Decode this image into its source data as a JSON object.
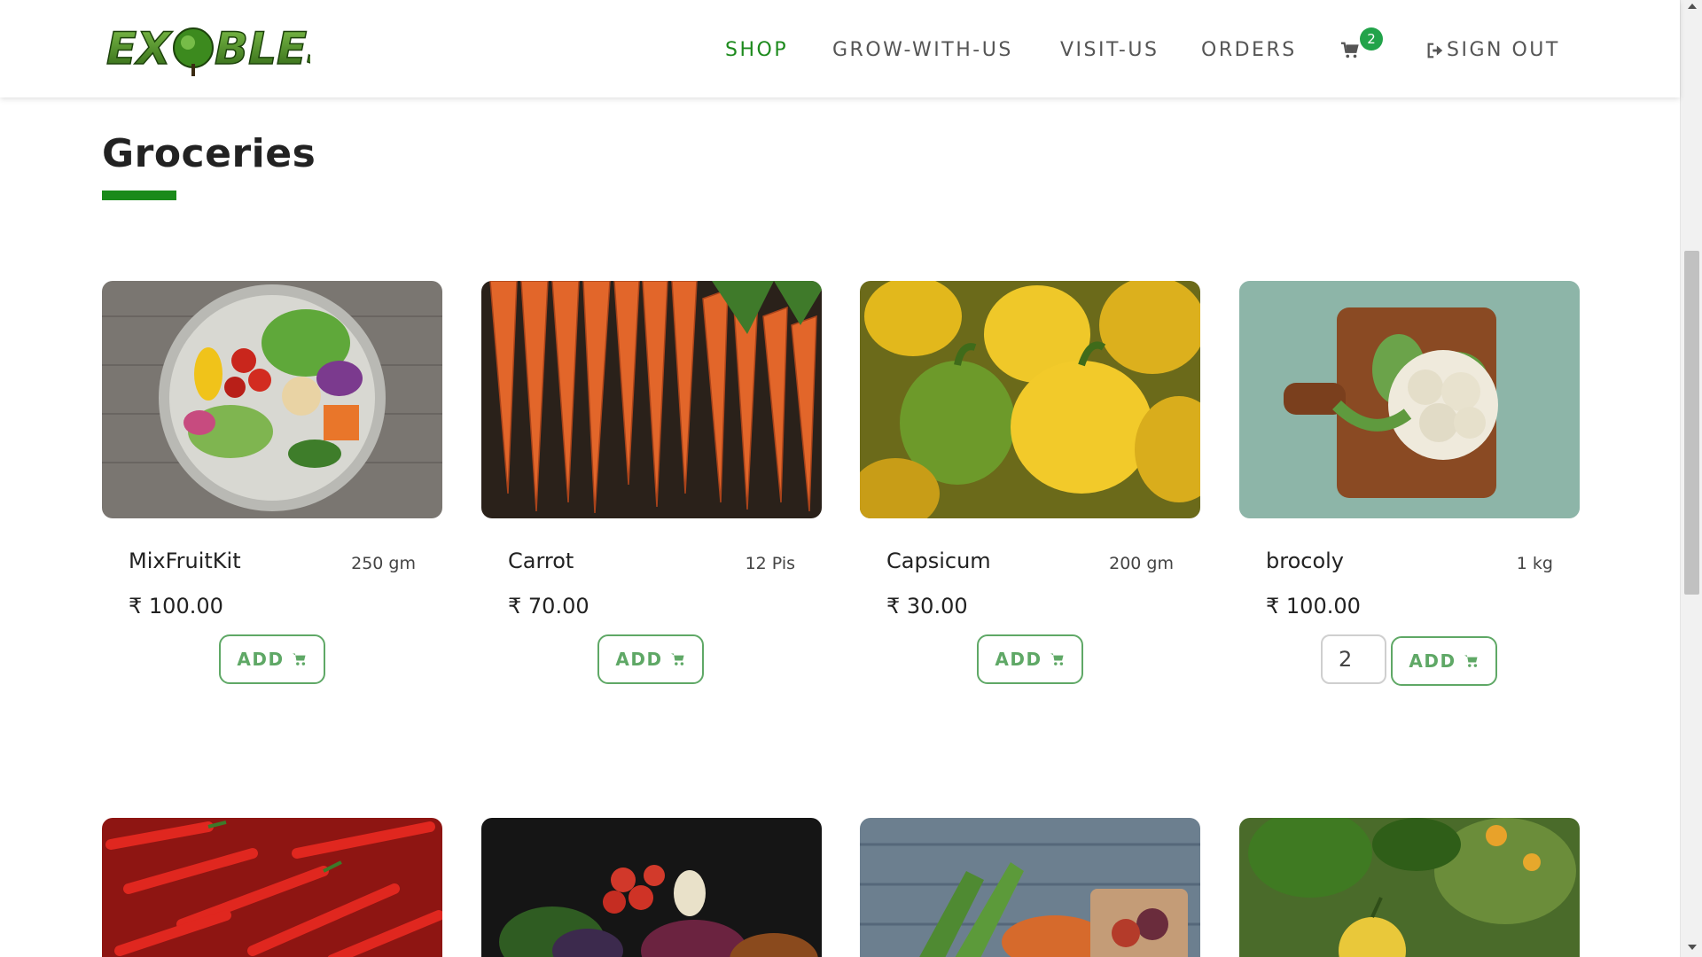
{
  "header": {
    "logo_text": "EXOBLES",
    "nav": [
      {
        "label": "SHOP",
        "active": true
      },
      {
        "label": "GROW-WITH-US",
        "active": false
      },
      {
        "label": "VISIT-US",
        "active": false
      },
      {
        "label": "ORDERS",
        "active": false
      }
    ],
    "cart_count": "2",
    "signout_label": "SIGN OUT"
  },
  "page": {
    "title": "Groceries",
    "accent_color": "#1a8a1a"
  },
  "products": [
    {
      "name": "MixFruitKit",
      "qty": "250 gm",
      "price": "₹ 100.00",
      "add_label": "ADD"
    },
    {
      "name": "Carrot",
      "qty": "12 Pis",
      "price": "₹ 70.00",
      "add_label": "ADD"
    },
    {
      "name": "Capsicum",
      "qty": "200 gm",
      "price": "₹ 30.00",
      "add_label": "ADD"
    },
    {
      "name": "brocoly",
      "qty": "1 kg",
      "price": "₹ 100.00",
      "add_label": "ADD",
      "quantity_value": "2"
    }
  ],
  "icons": {
    "cart": "cart-icon",
    "signout": "sign-out-icon"
  }
}
